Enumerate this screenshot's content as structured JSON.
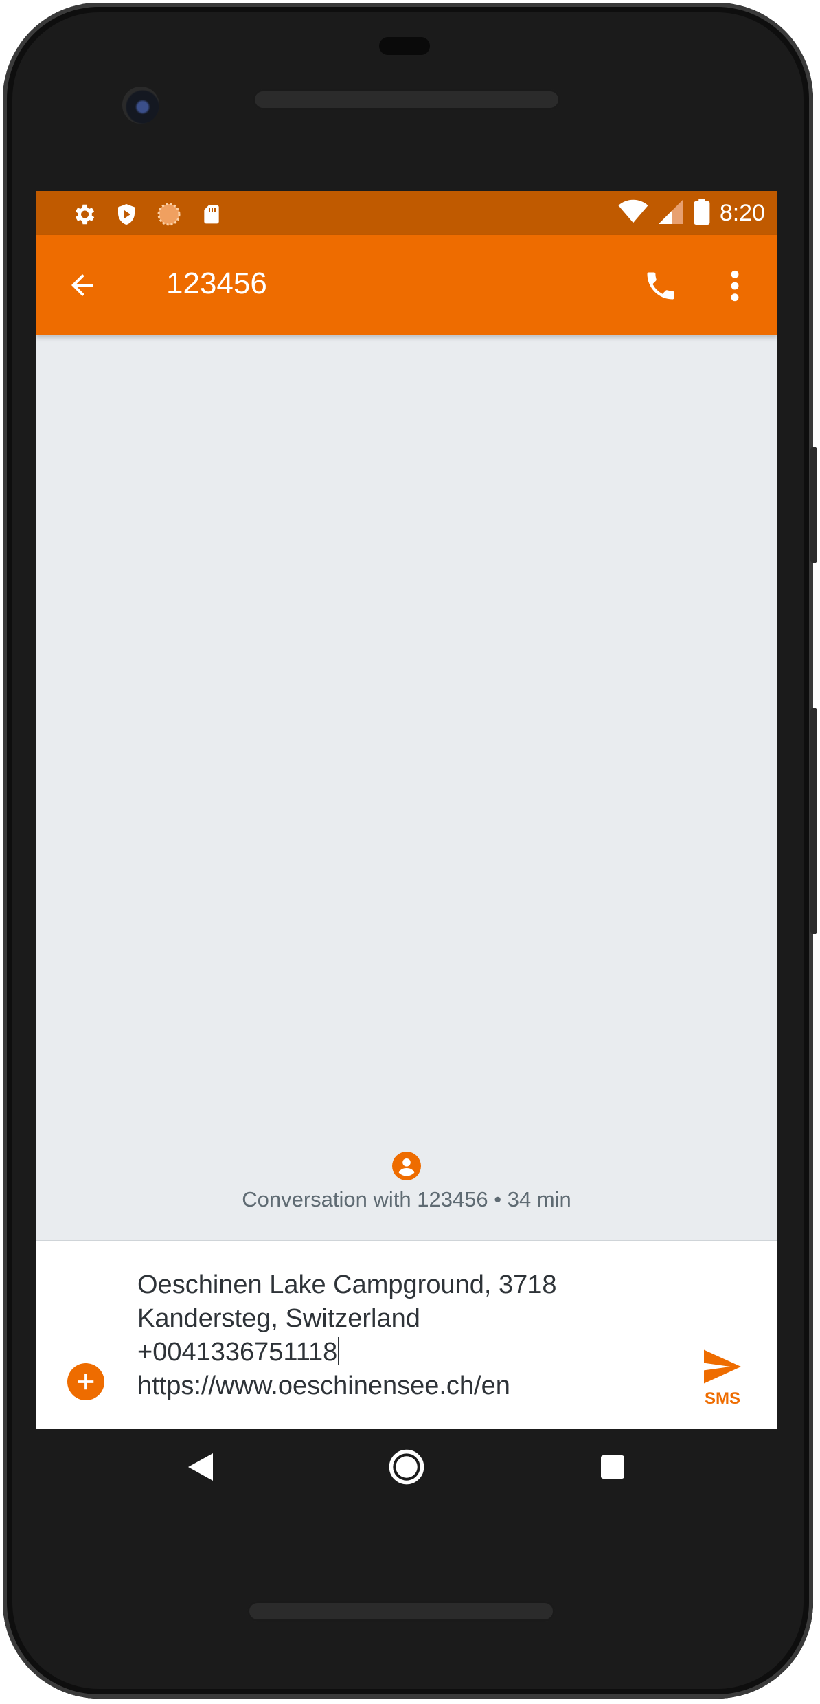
{
  "status_bar": {
    "time": "8:20",
    "left_icons": [
      "gear-icon",
      "shield-play-icon",
      "loading-circle-icon",
      "sd-card-icon"
    ],
    "right_icons": [
      "wifi-icon",
      "cell-signal-icon",
      "battery-icon"
    ]
  },
  "toolbar": {
    "title": "123456",
    "back_icon": "arrow-back-icon",
    "call_icon": "phone-icon",
    "more_icon": "more-vert-icon"
  },
  "conversation": {
    "info_text": "Conversation with 123456 • 34 min"
  },
  "compose": {
    "lines": [
      "Oeschinen Lake Campground, 3718",
      "Kandersteg, Switzerland",
      "+0041336751118",
      "https://www.oeschinensee.ch/en"
    ],
    "send_label": "SMS"
  },
  "colors": {
    "accent": "#ee6c00",
    "status_bar": "#c05a00",
    "background": "#e9ecef"
  }
}
